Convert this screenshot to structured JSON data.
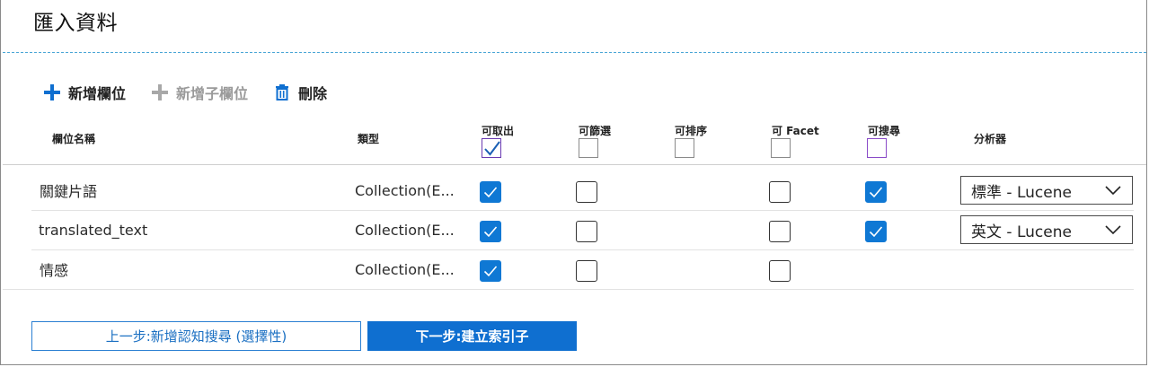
{
  "page": {
    "title": "匯入資料"
  },
  "toolbar": {
    "add_field": "新增欄位",
    "add_subfield": "新增子欄位",
    "delete": "刪除"
  },
  "columns": {
    "name": "欄位名稱",
    "type": "類型",
    "retrievable": "可取出",
    "filterable": "可篩選",
    "sortable": "可排序",
    "facetable": "可 Facet",
    "searchable": "可搜尋",
    "analyzer": "分析器"
  },
  "header_checks": {
    "retrievable": true,
    "filterable": false,
    "sortable": false,
    "facetable": false,
    "searchable": false
  },
  "rows": [
    {
      "name": "關鍵片語",
      "type": "Collection(E...",
      "retrievable": true,
      "filterable": false,
      "facetable": false,
      "searchable": true,
      "analyzer": "標準 - Lucene"
    },
    {
      "name": "translated_text",
      "type": "Collection(E...",
      "retrievable": true,
      "filterable": false,
      "facetable": false,
      "searchable": true,
      "analyzer": "英文 - Lucene"
    },
    {
      "name": "情感",
      "type": "Collection(E...",
      "retrievable": true,
      "filterable": false,
      "facetable": false,
      "searchable": null,
      "analyzer": null
    }
  ],
  "footer": {
    "prev_label": "上一步:新增認知搜尋 (選擇性)",
    "next_label": "下一步:建立索引子"
  },
  "colors": {
    "accent": "#0f78d4",
    "checkbox_on": "#0f78d4",
    "dashed_rule": "#4aa6d6"
  }
}
